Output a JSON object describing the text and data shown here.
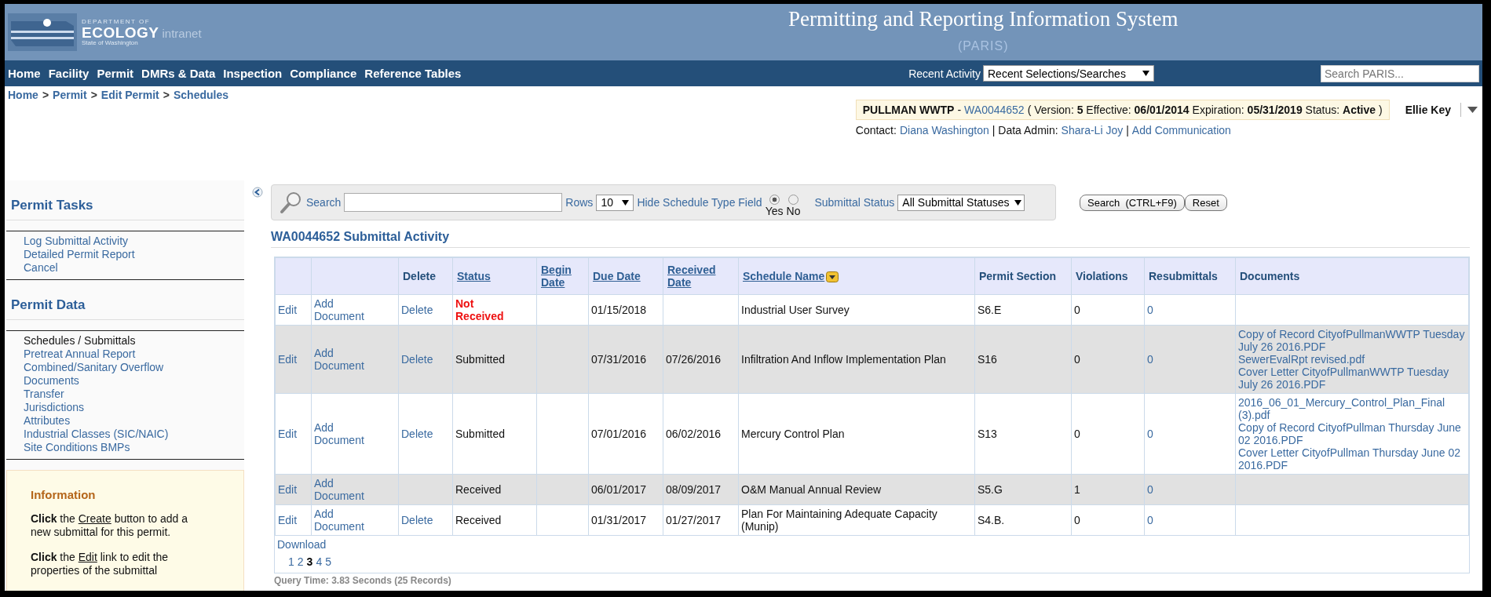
{
  "header": {
    "logo": {
      "top": "DEPARTMENT OF",
      "name": "ECOLOGY",
      "suffix": "intranet",
      "state": "State of Washington"
    },
    "title": "Permitting and Reporting Information System",
    "subtitle": "(PARIS)"
  },
  "nav": {
    "items": [
      "Home",
      "Facility",
      "Permit",
      "DMRs & Data",
      "Inspection",
      "Compliance",
      "Reference Tables"
    ],
    "recent_label": "Recent Activity",
    "recent_value": "Recent Selections/Searches",
    "search_placeholder": "Search PARIS..."
  },
  "breadcrumb": {
    "items": [
      "Home",
      "Permit",
      "Edit Permit",
      "Schedules"
    ],
    "separator": ">"
  },
  "permit_banner": {
    "facility": "PULLMAN WWTP",
    "dash": "-",
    "permit_id": "WA0044652",
    "details": "( Version: **5** Effective: **06/01/2014** Expiration: **05/31/2019** Status: **Active** )"
  },
  "user": {
    "name": "Ellie Key"
  },
  "contact_line": [
    {
      "kind": "text",
      "text": "Contact:"
    },
    {
      "kind": "link",
      "text": "Diana Washington"
    },
    {
      "kind": "text",
      "text": "| Data Admin:"
    },
    {
      "kind": "link",
      "text": "Shara-Li Joy"
    },
    {
      "kind": "text",
      "text": "|"
    },
    {
      "kind": "link",
      "text": "Add Communication"
    }
  ],
  "sidebar": {
    "sections": [
      {
        "title": "Permit Tasks",
        "items": [
          {
            "label": "Log Submittal Activity",
            "selected": false
          },
          {
            "label": "Detailed Permit Report",
            "selected": false
          },
          {
            "label": "Cancel",
            "selected": false
          }
        ]
      },
      {
        "title": "Permit Data",
        "items": [
          {
            "label": "Schedules / Submittals",
            "selected": true
          },
          {
            "label": "Pretreat Annual Report",
            "selected": false
          },
          {
            "label": "Combined/Sanitary Overflow",
            "selected": false
          },
          {
            "label": "Documents",
            "selected": false
          },
          {
            "label": "Transfer",
            "selected": false
          },
          {
            "label": "Jurisdictions",
            "selected": false
          },
          {
            "label": "Attributes",
            "selected": false
          },
          {
            "label": "Industrial Classes (SIC/NAIC)",
            "selected": false
          },
          {
            "label": "Site Conditions BMPs",
            "selected": false
          }
        ]
      }
    ],
    "info": {
      "title": "Information",
      "paragraphs": [
        {
          "before": "**Click** the ",
          "link": "Create",
          "after": " button to add a new submittal for this permit."
        },
        {
          "before": "**Click** the ",
          "link": "Edit",
          "after": " link to edit the properties of the submittal"
        }
      ]
    }
  },
  "search_panel": {
    "search_label": "Search",
    "rows_label": "Rows",
    "rows_value": "10",
    "hide_label": "Hide Schedule Type Field",
    "radios": [
      {
        "label": "Yes",
        "selected": true
      },
      {
        "label": "No",
        "selected": false
      }
    ],
    "status_label": "Submittal Status",
    "status_value": "All Submittal Statuses",
    "buttons": [
      "Search  (CTRL+F9)",
      "Reset"
    ]
  },
  "section_title": "WA0044652 Submittal Activity",
  "table": {
    "columns": [
      {},
      {},
      {
        "label": "Delete",
        "sortable": false
      },
      {
        "label": "Status",
        "sortable": true
      },
      {
        "label": "Begin Date",
        "sortable": true
      },
      {
        "label": "Due Date",
        "sortable": true
      },
      {
        "label": "Received Date",
        "sortable": true
      },
      {
        "label": "Schedule Name",
        "sortable": true,
        "filter": true
      },
      {
        "label": "Permit Section",
        "sortable": false
      },
      {
        "label": "Violations",
        "sortable": false
      },
      {
        "label": "Resubmittals",
        "sortable": false
      },
      {
        "label": "Documents",
        "sortable": false
      }
    ],
    "rows": [
      {
        "edit": "Edit",
        "add": "Add Document",
        "delete": "Delete",
        "status": "Not Received",
        "alert": true,
        "due": "01/15/2018",
        "name": "Industrial User Survey",
        "section": "S6.E",
        "violations": "0",
        "resubmittals": "0",
        "documents": []
      },
      {
        "edit": "Edit",
        "add": "Add Document",
        "delete": "Delete",
        "status": "Submitted",
        "alert": false,
        "due": "07/31/2016",
        "received": "07/26/2016",
        "name": "Infiltration And Inflow Implementation Plan",
        "section": "S16",
        "violations": "0",
        "resubmittals": "0",
        "documents": [
          "Copy of Record CityofPullmanWWTP Tuesday July 26 2016.PDF",
          "SewerEvalRpt revised.pdf",
          "Cover Letter CityofPullmanWWTP Tuesday July 26 2016.PDF"
        ]
      },
      {
        "edit": "Edit",
        "add": "Add Document",
        "delete": "Delete",
        "status": "Submitted",
        "alert": false,
        "due": "07/01/2016",
        "received": "06/02/2016",
        "name": "Mercury Control Plan",
        "section": "S13",
        "violations": "0",
        "resubmittals": "0",
        "documents": [
          "2016_06_01_Mercury_Control_Plan_Final (3).pdf",
          "Copy of Record CityofPullman Thursday June 02 2016.PDF",
          "Cover Letter CityofPullman Thursday June 02 2016.PDF"
        ]
      },
      {
        "edit": "Edit",
        "add": "Add Document",
        "status": "Received",
        "alert": false,
        "due": "06/01/2017",
        "received": "08/09/2017",
        "name": "O&M Manual Annual Review",
        "section": "S5.G",
        "violations": "1",
        "resubmittals": "0",
        "documents": []
      },
      {
        "edit": "Edit",
        "add": "Add Document",
        "delete": "Delete",
        "status": "Received",
        "alert": false,
        "due": "01/31/2017",
        "received": "01/27/2017",
        "name": "Plan For Maintaining Adequate Capacity (Munip)",
        "section": "S4.B.",
        "violations": "0",
        "resubmittals": "0",
        "documents": []
      }
    ],
    "download": "Download",
    "pages": [
      {
        "label": "1",
        "selected": false
      },
      {
        "label": "2",
        "selected": false
      },
      {
        "label": "3",
        "selected": true
      },
      {
        "label": "4",
        "selected": false
      },
      {
        "label": "5",
        "selected": false
      }
    ]
  },
  "query_time": "Query Time: 3.83 Seconds (25 Records)"
}
